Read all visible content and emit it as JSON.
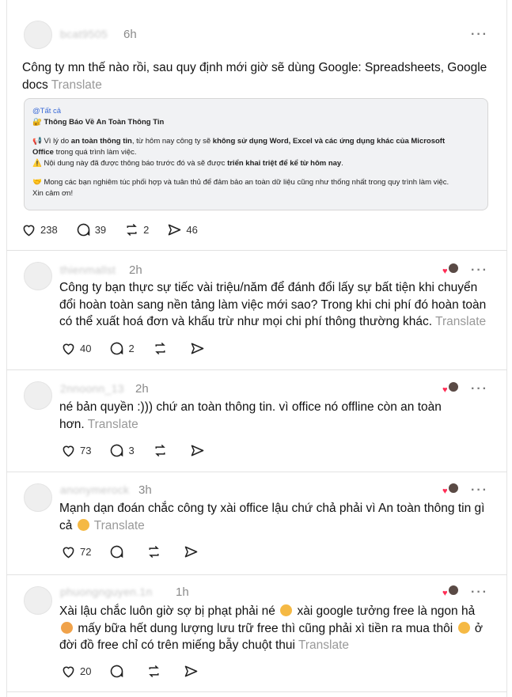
{
  "posts": [
    {
      "username": "bcat9505",
      "time": "6h",
      "text": "Công ty mn thế nào rồi, sau quy định mới giờ sẽ dùng Google: Spreadsheets, Google docs",
      "translate": "Translate",
      "embed": {
        "tag": "@Tất cả",
        "title": "🔐 Thông Báo Về An Toàn Thông Tin",
        "line1_a": "📢 Vì lý do ",
        "line1_b": "an toàn thông tin",
        "line1_c": ", từ hôm nay công ty sẽ ",
        "line1_d": "không sử dụng Word, Excel và các ứng dụng khác của Microsoft",
        "line2_a": "Office",
        "line2_b": " trong quá trình làm việc.",
        "line3_a": "⚠️ Nội dung này đã được thông báo trước đó và sẽ được ",
        "line3_b": "triển khai triệt để kể từ hôm nay",
        "line3_c": ".",
        "line4": "🤝 Mong các bạn nghiêm túc phối hợp và tuân thủ để đảm bảo an toàn dữ liệu cũng như thống nhất trong quy trình làm việc.",
        "line5": "Xin cảm ơn!"
      },
      "likes": "238",
      "comments": "39",
      "reposts": "2",
      "shares": "46"
    },
    {
      "username": "thienmallst",
      "time": "2h",
      "text": "Công ty bạn thực sự tiếc vài triệu/năm để đánh đổi lấy sự bất tiện khi chuyển đổi hoàn toàn sang nền tảng làm việc mới sao? Trong khi chi phí đó hoàn toàn có thể xuất hoá đơn và khấu trừ như mọi chi phí thông thường khác.",
      "translate": "Translate",
      "likes": "40",
      "comments": "2"
    },
    {
      "username": "2nnoonn_13",
      "time": "2h",
      "text": "né bản quyền :))) chứ an toàn thông tin. vì office nó offline còn an toàn hơn.",
      "translate": "Translate",
      "likes": "73",
      "comments": "3"
    },
    {
      "username": "anonymerock",
      "time": "3h",
      "text": "Mạnh dạn đoán chắc công ty xài office lậu chứ chả phải vì An toàn thông tin gì cả",
      "translate": "Translate",
      "likes": "72"
    },
    {
      "username": "phuongnguyen.1n",
      "time": "1h",
      "text_a": "Xài lậu chắc luôn giờ sợ bị phạt phải né",
      "text_b": "xài google tưởng free là ngon hả",
      "text_c": "mấy bữa hết dung lượng lưu trữ free thì cũng phải xì tiền ra mua thôi",
      "text_d": "ở đời đồ free chỉ có trên miếng bẫy chuột thui",
      "translate": "Translate",
      "likes": "20"
    }
  ],
  "colors": {
    "heart_badge": "#ff2d55",
    "translate": "#999999",
    "link_tag": "#3a6ad6"
  },
  "icons": [
    "heart-icon",
    "comment-icon",
    "repost-icon",
    "share-icon",
    "more-icon"
  ]
}
